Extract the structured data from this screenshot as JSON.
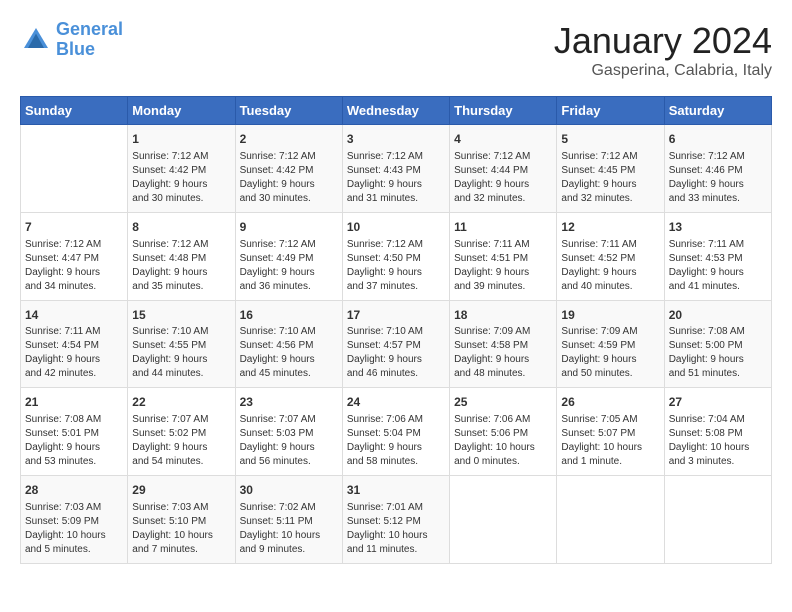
{
  "header": {
    "logo_line1": "General",
    "logo_line2": "Blue",
    "title": "January 2024",
    "subtitle": "Gasperina, Calabria, Italy"
  },
  "days_of_week": [
    "Sunday",
    "Monday",
    "Tuesday",
    "Wednesday",
    "Thursday",
    "Friday",
    "Saturday"
  ],
  "weeks": [
    [
      {
        "day": "",
        "content": ""
      },
      {
        "day": "1",
        "content": "Sunrise: 7:12 AM\nSunset: 4:42 PM\nDaylight: 9 hours\nand 30 minutes."
      },
      {
        "day": "2",
        "content": "Sunrise: 7:12 AM\nSunset: 4:42 PM\nDaylight: 9 hours\nand 30 minutes."
      },
      {
        "day": "3",
        "content": "Sunrise: 7:12 AM\nSunset: 4:43 PM\nDaylight: 9 hours\nand 31 minutes."
      },
      {
        "day": "4",
        "content": "Sunrise: 7:12 AM\nSunset: 4:44 PM\nDaylight: 9 hours\nand 32 minutes."
      },
      {
        "day": "5",
        "content": "Sunrise: 7:12 AM\nSunset: 4:45 PM\nDaylight: 9 hours\nand 32 minutes."
      },
      {
        "day": "6",
        "content": "Sunrise: 7:12 AM\nSunset: 4:46 PM\nDaylight: 9 hours\nand 33 minutes."
      }
    ],
    [
      {
        "day": "7",
        "content": "Sunrise: 7:12 AM\nSunset: 4:47 PM\nDaylight: 9 hours\nand 34 minutes."
      },
      {
        "day": "8",
        "content": "Sunrise: 7:12 AM\nSunset: 4:48 PM\nDaylight: 9 hours\nand 35 minutes."
      },
      {
        "day": "9",
        "content": "Sunrise: 7:12 AM\nSunset: 4:49 PM\nDaylight: 9 hours\nand 36 minutes."
      },
      {
        "day": "10",
        "content": "Sunrise: 7:12 AM\nSunset: 4:50 PM\nDaylight: 9 hours\nand 37 minutes."
      },
      {
        "day": "11",
        "content": "Sunrise: 7:11 AM\nSunset: 4:51 PM\nDaylight: 9 hours\nand 39 minutes."
      },
      {
        "day": "12",
        "content": "Sunrise: 7:11 AM\nSunset: 4:52 PM\nDaylight: 9 hours\nand 40 minutes."
      },
      {
        "day": "13",
        "content": "Sunrise: 7:11 AM\nSunset: 4:53 PM\nDaylight: 9 hours\nand 41 minutes."
      }
    ],
    [
      {
        "day": "14",
        "content": "Sunrise: 7:11 AM\nSunset: 4:54 PM\nDaylight: 9 hours\nand 42 minutes."
      },
      {
        "day": "15",
        "content": "Sunrise: 7:10 AM\nSunset: 4:55 PM\nDaylight: 9 hours\nand 44 minutes."
      },
      {
        "day": "16",
        "content": "Sunrise: 7:10 AM\nSunset: 4:56 PM\nDaylight: 9 hours\nand 45 minutes."
      },
      {
        "day": "17",
        "content": "Sunrise: 7:10 AM\nSunset: 4:57 PM\nDaylight: 9 hours\nand 46 minutes."
      },
      {
        "day": "18",
        "content": "Sunrise: 7:09 AM\nSunset: 4:58 PM\nDaylight: 9 hours\nand 48 minutes."
      },
      {
        "day": "19",
        "content": "Sunrise: 7:09 AM\nSunset: 4:59 PM\nDaylight: 9 hours\nand 50 minutes."
      },
      {
        "day": "20",
        "content": "Sunrise: 7:08 AM\nSunset: 5:00 PM\nDaylight: 9 hours\nand 51 minutes."
      }
    ],
    [
      {
        "day": "21",
        "content": "Sunrise: 7:08 AM\nSunset: 5:01 PM\nDaylight: 9 hours\nand 53 minutes."
      },
      {
        "day": "22",
        "content": "Sunrise: 7:07 AM\nSunset: 5:02 PM\nDaylight: 9 hours\nand 54 minutes."
      },
      {
        "day": "23",
        "content": "Sunrise: 7:07 AM\nSunset: 5:03 PM\nDaylight: 9 hours\nand 56 minutes."
      },
      {
        "day": "24",
        "content": "Sunrise: 7:06 AM\nSunset: 5:04 PM\nDaylight: 9 hours\nand 58 minutes."
      },
      {
        "day": "25",
        "content": "Sunrise: 7:06 AM\nSunset: 5:06 PM\nDaylight: 10 hours\nand 0 minutes."
      },
      {
        "day": "26",
        "content": "Sunrise: 7:05 AM\nSunset: 5:07 PM\nDaylight: 10 hours\nand 1 minute."
      },
      {
        "day": "27",
        "content": "Sunrise: 7:04 AM\nSunset: 5:08 PM\nDaylight: 10 hours\nand 3 minutes."
      }
    ],
    [
      {
        "day": "28",
        "content": "Sunrise: 7:03 AM\nSunset: 5:09 PM\nDaylight: 10 hours\nand 5 minutes."
      },
      {
        "day": "29",
        "content": "Sunrise: 7:03 AM\nSunset: 5:10 PM\nDaylight: 10 hours\nand 7 minutes."
      },
      {
        "day": "30",
        "content": "Sunrise: 7:02 AM\nSunset: 5:11 PM\nDaylight: 10 hours\nand 9 minutes."
      },
      {
        "day": "31",
        "content": "Sunrise: 7:01 AM\nSunset: 5:12 PM\nDaylight: 10 hours\nand 11 minutes."
      },
      {
        "day": "",
        "content": ""
      },
      {
        "day": "",
        "content": ""
      },
      {
        "day": "",
        "content": ""
      }
    ]
  ]
}
